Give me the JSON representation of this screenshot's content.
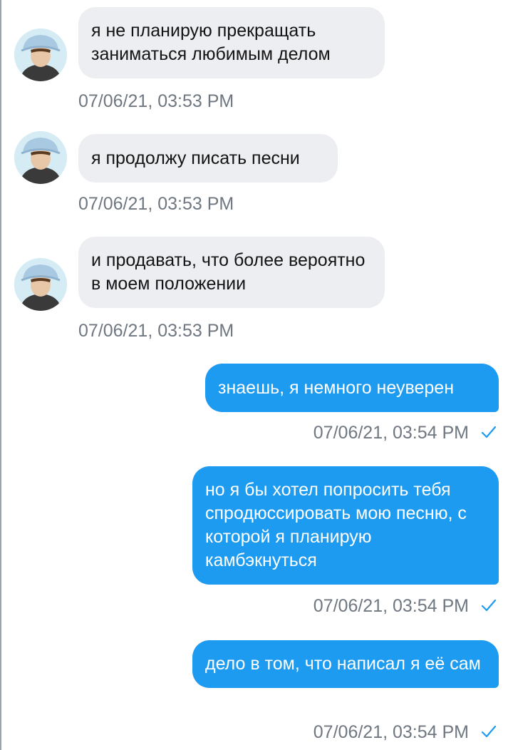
{
  "conversation": {
    "messages": [
      {
        "direction": "incoming",
        "text": "я не планирую прекращать заниматься любимым делом",
        "timestamp": "07/06/21, 03:53 PM"
      },
      {
        "direction": "incoming",
        "text": "я продолжу писать песни",
        "timestamp": "07/06/21, 03:53 PM"
      },
      {
        "direction": "incoming",
        "text": "и продавать, что более вероятно в моем положении",
        "timestamp": "07/06/21, 03:53 PM"
      },
      {
        "direction": "outgoing",
        "text": "знаешь, я немного неуверен",
        "timestamp": "07/06/21, 03:54 PM",
        "status_icon": "check-icon"
      },
      {
        "direction": "outgoing",
        "text": "но я бы хотел попросить тебя спродюссировать мою песню, с которой я планирую камбэкнуться",
        "timestamp": "07/06/21, 03:54 PM",
        "status_icon": "check-icon"
      },
      {
        "direction": "outgoing",
        "text": "дело в том, что написал я её сам",
        "timestamp": "07/06/21, 03:54 PM",
        "status_icon": "check-icon"
      }
    ]
  },
  "colors": {
    "incoming_bubble": "#edeef2",
    "outgoing_bubble": "#1d9bf0",
    "timestamp": "#6f7780",
    "check": "#1d9bf0"
  }
}
